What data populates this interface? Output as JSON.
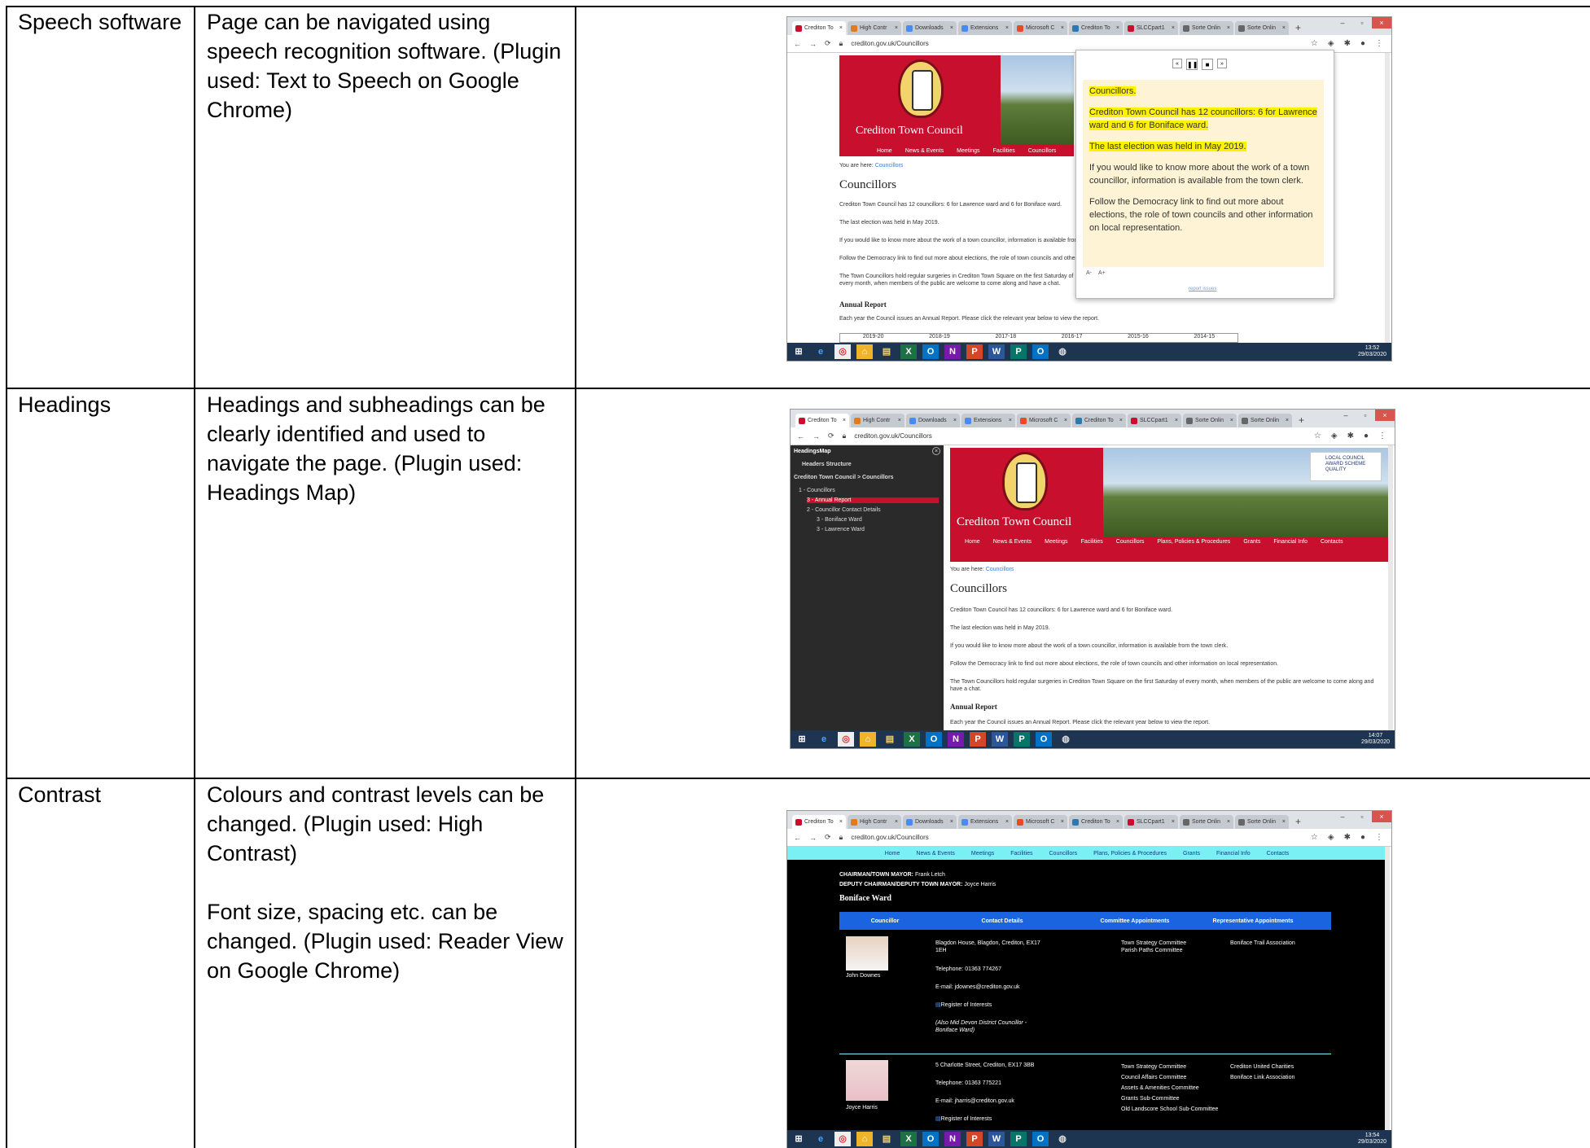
{
  "rows": [
    {
      "feature": "Speech software",
      "descriptions": [
        "Page can be navigated using speech recognition software. (Plugin used: Text to Speech on Google Chrome)"
      ]
    },
    {
      "feature": "Headings",
      "descriptions": [
        "Headings and subheadings can be clearly identified and used to navigate the page. (Plugin used: Headings Map)"
      ]
    },
    {
      "feature": "Contrast",
      "descriptions": [
        "Colours and contrast levels can be changed. (Plugin used: High Contrast)",
        "Font size, spacing etc. can be changed. (Plugin used: Reader View on Google Chrome)"
      ]
    }
  ],
  "browser": {
    "tabs": [
      "Crediton To",
      "High Contr",
      "Downloads",
      "Extensions",
      "Microsoft C",
      "Crediton To",
      "SLCCpart1",
      "Sorte Onlin",
      "Sorte Onlin"
    ],
    "url": "crediton.gov.uk/Councillors",
    "taskbar_icons": [
      "⊞",
      "e",
      "◎",
      "⌂",
      "▤",
      "X",
      "O",
      "N",
      "P",
      "W",
      "P",
      "O",
      "◍"
    ]
  },
  "site": {
    "council_name": "Crediton Town Council",
    "nav": [
      "Home",
      "News & Events",
      "Meetings",
      "Facilities",
      "Councillors",
      "Plans, Policies & Procedures",
      "Grants",
      "Financial Info",
      "Contacts"
    ],
    "breadcrumb_label": "You are here:",
    "breadcrumb_link": "Councillors",
    "heading": "Councillors",
    "paragraphs": [
      "Crediton Town Council has 12 councillors: 6 for Lawrence ward and 6 for Boniface ward.",
      "The last election was held in May 2019.",
      "If you would like to know more about the work of a town councillor, information is available from the town clerk.",
      "Follow the Democracy link to find out more about elections, the role of town councils and other information on local representation.",
      "The Town Councillors hold regular surgeries in Crediton Town Square on the first Saturday of every month, when members of the public are welcome to come along and have a chat."
    ],
    "annual_report_heading": "Annual Report",
    "annual_report_text": "Each year the Council issues an Annual Report. Please click the relevant year below to view the report.",
    "years": [
      "2019-20",
      "2018-19",
      "2017-18",
      "2016-17",
      "2015-16",
      "2014-15"
    ],
    "award_badge": "LOCAL COUNCIL AWARD SCHEME QUALITY"
  },
  "tts": {
    "lines": [
      "Councillors.",
      "Crediton Town Council has 12 councillors: 6 for Lawrence ward and 6 for Boniface ward.",
      "The last election was held in May 2019.",
      "If you would like to know more about the work of a town councillor, information is available from the town clerk.",
      "Follow the Democracy link to find out more about elections, the role of town councils and other information on local representation."
    ],
    "font_small": "A-",
    "font_large": "A+",
    "report": "report issues"
  },
  "headingsmap": {
    "title": "HeadingsMap",
    "section": "Headers Structure",
    "path": "Crediton Town Council > Councillors",
    "items": [
      "1 - Councillors",
      "3 - Annual Report",
      "2 - Councillor Contact Details",
      "3 - Boniface Ward",
      "3 - Lawrence Ward"
    ]
  },
  "contrast": {
    "chair_label": "CHAIRMAN/TOWN MAYOR:",
    "chair_name": "Frank Letch",
    "deputy_label": "DEPUTY CHAIRMAN/DEPUTY TOWN MAYOR:",
    "deputy_name": "Joyce Harris",
    "ward": "Boniface Ward",
    "headers": [
      "Councillor",
      "Contact Details",
      "Committee Appointments",
      "Representative Appointments"
    ],
    "councillors": [
      {
        "name": "John Downes",
        "address": "Blagdon House, Blagdon, Crediton, EX17 1EH",
        "phone": "Telephone: 01363 774267",
        "email": "E-mail: jdownes@crediton.gov.uk",
        "register": "Register of Interests",
        "note": "(Also Mid Devon District Councillor - Boniface Ward)",
        "committees": [
          "Town Strategy Committee",
          "Parish Paths Committee"
        ],
        "representative": [
          "Boniface Trail Association"
        ]
      },
      {
        "name": "Joyce Harris",
        "address": "5 Charlotte Street, Crediton, EX17 3BB",
        "phone": "Telephone: 01363 775221",
        "email": "E-mail: jharris@crediton.gov.uk",
        "register": "Register of Interests",
        "note": "",
        "committees": [
          "Town Strategy Committee",
          "Council Affairs Committee",
          "Assets & Amenities Committee",
          "Grants Sub-Committee",
          "Old Landscore School Sub-Committee"
        ],
        "representative": [
          "Crediton United Charities",
          "Boniface Link Association"
        ]
      }
    ]
  },
  "clock": {
    "time1": "13:52",
    "time2": "14:07",
    "time3": "13:54",
    "date": "29/03/2020"
  },
  "colors": {
    "red": "#c8102e",
    "highlight": "#fff200",
    "cyan": "#7af0f5",
    "blue_header": "#1a64e0"
  }
}
